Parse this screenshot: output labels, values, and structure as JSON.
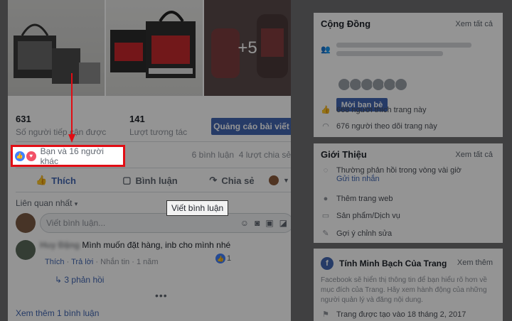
{
  "post": {
    "photos": {
      "more_count": "+5"
    },
    "stats": {
      "reach_num": "631",
      "reach_label": "Số người tiếp cận được",
      "engage_num": "141",
      "engage_label": "Lượt tương tác"
    },
    "promote_label": "Quảng cáo bài viết",
    "reactions": {
      "text": "Bạn và 16 người khác",
      "comments": "6 bình luận",
      "shares": "4 lượt chia sẻ"
    },
    "actions": {
      "like": "Thích",
      "comment": "Bình luận",
      "share": "Chia sẻ"
    },
    "sort_label": "Liên quan nhất",
    "tooltip": "Viết bình luận",
    "comment_placeholder": "Viết bình luận...",
    "comment": {
      "author": "Huy Đặng",
      "text": "Mình muốn đặt hàng, inb cho mình nhé",
      "like": "Thích",
      "reply": "Trả lời",
      "message": "Nhắn tin",
      "time": "1 năm",
      "reaction_count": "1",
      "replies": "3 phản hồi"
    },
    "more_comments": "Xem thêm 1 bình luận"
  },
  "community": {
    "title": "Cộng Đồng",
    "see_all": "Xem tất cả",
    "invite": "Mời bạn bè",
    "likes": "668 người thích trang này",
    "follows": "676 người theo dõi trang này"
  },
  "about": {
    "title": "Giới Thiệu",
    "see_all": "Xem tất cả",
    "response_line1": "Thường phản hồi trong vòng vài giờ",
    "send_message": "Gửi tin nhắn",
    "add_website": "Thêm trang web",
    "products": "Sản phẩm/Dịch vụ",
    "suggest_edit": "Gợi ý chỉnh sửa"
  },
  "transparency": {
    "title": "Tính Minh Bạch Của Trang",
    "see_more": "Xem thêm",
    "description": "Facebook sẽ hiển thị thông tin để bạn hiểu rõ hơn về mục đích của Trang. Hãy xem hành động của những người quản lý và đăng nội dung.",
    "created": "Trang được tạo vào 18 tháng 2, 2017"
  }
}
